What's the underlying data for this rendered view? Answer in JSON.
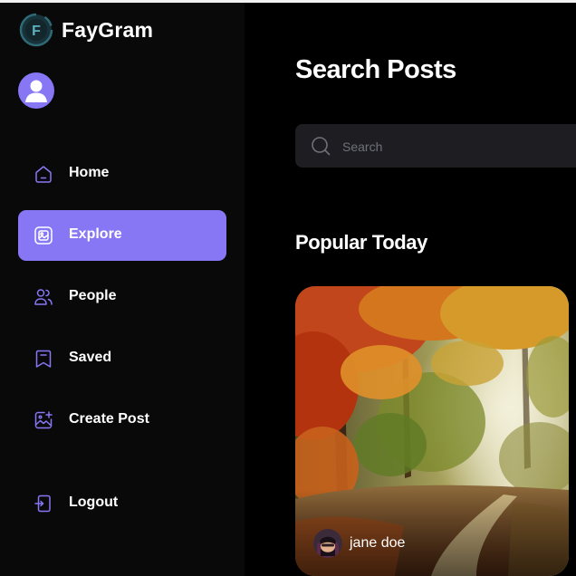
{
  "brand": {
    "name": "FayGram",
    "logo_letter": "F"
  },
  "nav": {
    "items": [
      {
        "label": "Home",
        "icon": "home-icon",
        "active": false
      },
      {
        "label": "Explore",
        "icon": "explore-icon",
        "active": true
      },
      {
        "label": "People",
        "icon": "people-icon",
        "active": false
      },
      {
        "label": "Saved",
        "icon": "saved-icon",
        "active": false
      },
      {
        "label": "Create Post",
        "icon": "create-post-icon",
        "active": false
      }
    ],
    "logout_label": "Logout"
  },
  "main": {
    "title": "Search Posts",
    "search_placeholder": "Search",
    "section_title": "Popular Today",
    "posts": [
      {
        "username": "jane doe"
      }
    ]
  },
  "colors": {
    "accent": "#8777F5",
    "sidebar_bg": "#09090A",
    "main_bg": "#000000",
    "search_bg": "#1E1E22"
  }
}
